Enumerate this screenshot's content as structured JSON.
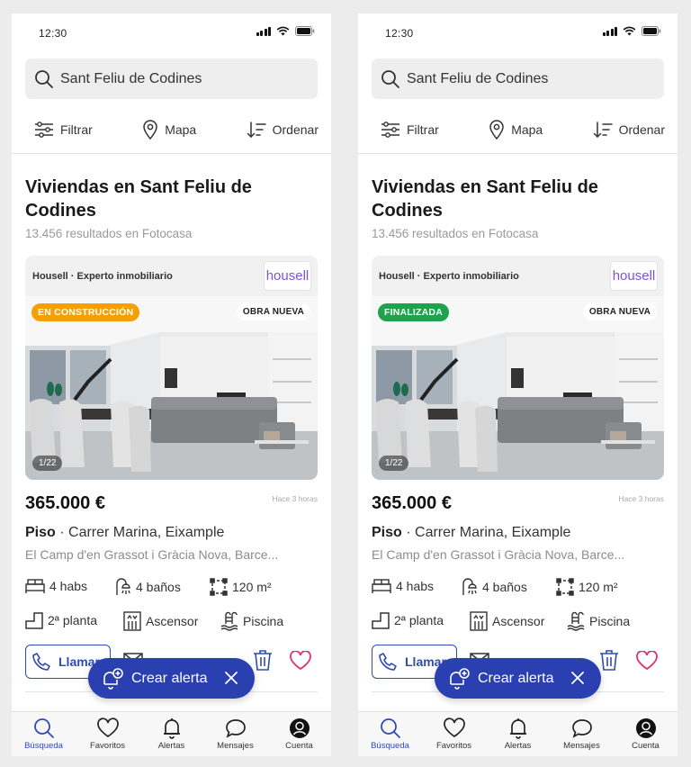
{
  "screens": [
    {
      "status": {
        "time": "12:30"
      },
      "search": {
        "value": "Sant Feliu de Codines"
      },
      "tools": {
        "filter": "Filtrar",
        "map": "Mapa",
        "sort": "Ordenar"
      },
      "heading": {
        "title": "Viviendas en Sant Feliu de Codines",
        "subtitle": "13.456 resultados en Fotocasa"
      },
      "card": {
        "agency": "Housell · Experto inmobiliario",
        "logo": "housell",
        "status_badge": "EN CONSTRUCCIÓN",
        "status_color": "#f5a000",
        "type_badge": "OBRA NUEVA",
        "photo_counter": "1/22"
      },
      "listing": {
        "price": "365.000 €",
        "time_ago": "Hace 3 horas",
        "type": "Piso",
        "street": "· Carrer Marina, Eixample",
        "area": "El Camp d'en Grassot i Gràcia Nova, Barce...",
        "rooms": "4 habs",
        "baths": "4 baños",
        "size": "120 m²",
        "floor": "2ª planta",
        "lift": "Ascensor",
        "pool": "Piscina"
      },
      "call_label": "Llamar",
      "alert_label": "Crear alerta"
    },
    {
      "status": {
        "time": "12:30"
      },
      "search": {
        "value": "Sant Feliu de Codines"
      },
      "tools": {
        "filter": "Filtrar",
        "map": "Mapa",
        "sort": "Ordenar"
      },
      "heading": {
        "title": "Viviendas en Sant Feliu de Codines",
        "subtitle": "13.456 resultados en Fotocasa"
      },
      "card": {
        "agency": "Housell · Experto inmobiliario",
        "logo": "housell",
        "status_badge": "FINALIZADA",
        "status_color": "#1ea34a",
        "type_badge": "OBRA NUEVA",
        "photo_counter": "1/22"
      },
      "listing": {
        "price": "365.000 €",
        "time_ago": "Hace 3 horas",
        "type": "Piso",
        "street": "· Carrer Marina, Eixample",
        "area": "El Camp d'en Grassot i Gràcia Nova, Barce...",
        "rooms": "4 habs",
        "baths": "4 baños",
        "size": "120 m²",
        "floor": "2ª planta",
        "lift": "Ascensor",
        "pool": "Piscina"
      },
      "call_label": "Llamar",
      "alert_label": "Crear alerta"
    }
  ],
  "tabbar": {
    "search": "Búsqueda",
    "favorites": "Favoritos",
    "alerts": "Alertas",
    "messages": "Mensajes",
    "account": "Cuenta"
  },
  "colors": {
    "accent": "#2e4bb5",
    "alert_bg": "#2a3fb0",
    "heart": "#e0306e"
  }
}
